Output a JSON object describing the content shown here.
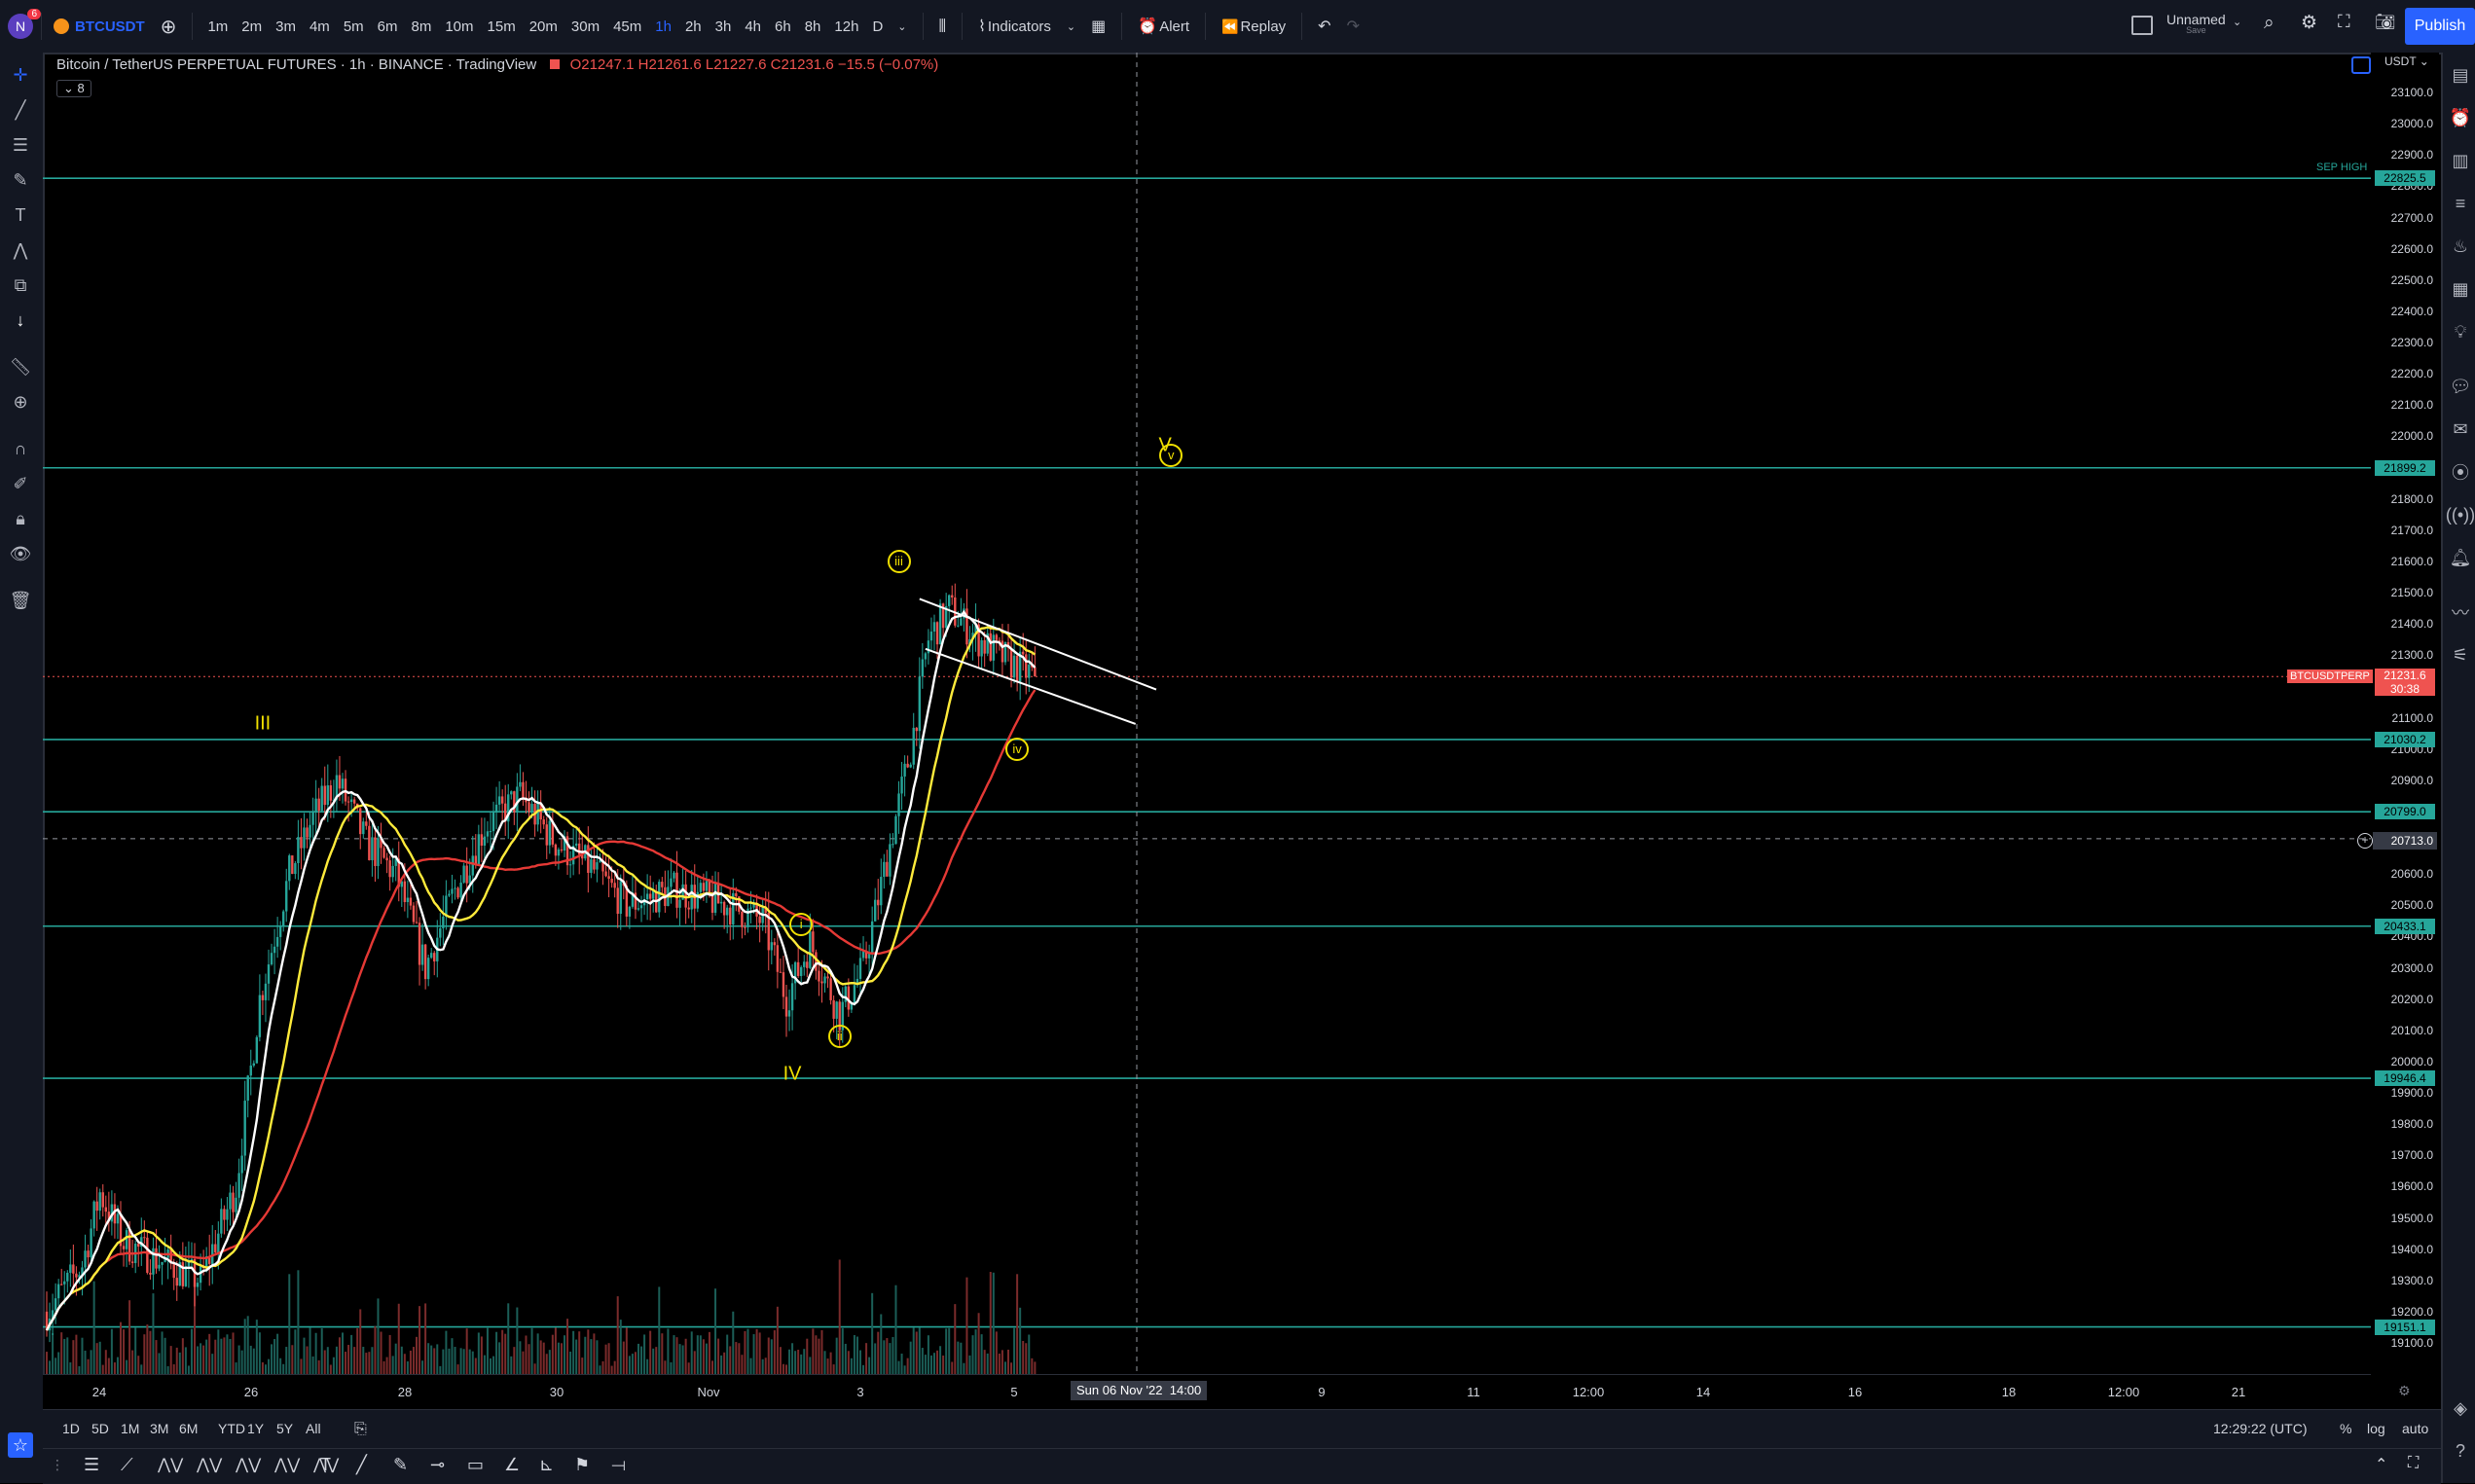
{
  "topbar": {
    "symbol": "BTCUSDT",
    "notif_count": "6",
    "intervals": [
      "1m",
      "2m",
      "3m",
      "4m",
      "5m",
      "6m",
      "8m",
      "10m",
      "15m",
      "20m",
      "30m",
      "45m",
      "1h",
      "2h",
      "3h",
      "4h",
      "6h",
      "8h",
      "12h",
      "D"
    ],
    "active_interval": "1h",
    "indicators_label": "Indicators",
    "alert_label": "Alert",
    "replay_label": "Replay",
    "layout_name": "Unnamed",
    "layout_sub": "Save",
    "publish_label": "Publish"
  },
  "legend": {
    "title": "Bitcoin / TetherUS PERPETUAL FUTURES · 1h · BINANCE · TradingView",
    "open": "O21247.1",
    "high": "H21261.6",
    "low": "L21227.6",
    "close": "C21231.6",
    "change": "−15.5 (−0.07%)",
    "indicator_count": "8"
  },
  "price_scale": {
    "currency": "USDT",
    "ticks": [
      "23100.0",
      "23000.0",
      "22900.0",
      "22800.0",
      "22700.0",
      "22600.0",
      "22500.0",
      "22400.0",
      "22300.0",
      "22200.0",
      "22100.0",
      "22000.0",
      "21900.0",
      "21800.0",
      "21700.0",
      "21600.0",
      "21500.0",
      "21400.0",
      "21300.0",
      "21200.0",
      "21100.0",
      "21000.0",
      "20900.0",
      "20800.0",
      "20700.0",
      "20600.0",
      "20500.0",
      "20400.0",
      "20300.0",
      "20200.0",
      "20100.0",
      "20000.0",
      "19900.0",
      "19800.0",
      "19700.0",
      "19600.0",
      "19500.0",
      "19400.0",
      "19300.0",
      "19200.0",
      "19100.0"
    ],
    "level_labels": [
      "22825.5",
      "21899.2",
      "21030.2",
      "20799.0",
      "20433.1",
      "19946.4",
      "19151.1"
    ],
    "sep_high_label": "SEP HIGH",
    "symbol_tag": "BTCUSDTPERP",
    "last_price": "21231.6",
    "countdown": "30:38",
    "crosshair_price": "20713.0"
  },
  "time_axis": {
    "labels": [
      "24",
      "26",
      "28",
      "30",
      "Nov",
      "3",
      "5",
      "9",
      "11",
      "12:00",
      "14",
      "16",
      "18",
      "12:00",
      "21"
    ],
    "crosshair": "Sun 06 Nov '22",
    "crosshair_time": "14:00"
  },
  "bottom_bar": {
    "ranges": [
      "1D",
      "5D",
      "1M",
      "3M",
      "6M",
      "YTD",
      "1Y",
      "5Y",
      "All"
    ],
    "clock": "12:29:22 (UTC)",
    "pct": "%",
    "log": "log",
    "auto": "auto"
  },
  "annotations": {
    "wave_III": "III",
    "wave_IV": "IV",
    "wave_V": "V",
    "sub_i": "i",
    "sub_ii": "ii",
    "sub_iii": "iii",
    "sub_iv": "iv",
    "sub_v": "v"
  },
  "colors": {
    "horizontal_levels": "#26a69a",
    "ma_fast": "#ffffff",
    "ma_mid": "#ffeb3b",
    "ma_slow": "#e53935",
    "up_candle": "#26a69a",
    "down_candle": "#ef5350",
    "wave_labels": "#f0e000"
  },
  "chart_data": {
    "type": "candlestick",
    "symbol": "BTCUSDT.P",
    "interval": "1h",
    "ylim": [
      19050,
      23150
    ],
    "horizontal_levels": [
      22825.5,
      21899.2,
      21030.2,
      20799.0,
      20433.1,
      19946.4,
      19151.1
    ],
    "last_price": 21231.6,
    "price_path_anchors": [
      {
        "t": 0,
        "p": 19200
      },
      {
        "t": 12,
        "p": 19350
      },
      {
        "t": 18,
        "p": 19580
      },
      {
        "t": 26,
        "p": 19420
      },
      {
        "t": 52,
        "p": 19300
      },
      {
        "t": 64,
        "p": 19600
      },
      {
        "t": 72,
        "p": 20200
      },
      {
        "t": 82,
        "p": 20600
      },
      {
        "t": 90,
        "p": 20780
      },
      {
        "t": 98,
        "p": 20900
      },
      {
        "t": 108,
        "p": 20700
      },
      {
        "t": 118,
        "p": 20600
      },
      {
        "t": 128,
        "p": 20300
      },
      {
        "t": 138,
        "p": 20550
      },
      {
        "t": 148,
        "p": 20750
      },
      {
        "t": 160,
        "p": 20850
      },
      {
        "t": 172,
        "p": 20700
      },
      {
        "t": 184,
        "p": 20620
      },
      {
        "t": 196,
        "p": 20500
      },
      {
        "t": 212,
        "p": 20550
      },
      {
        "t": 230,
        "p": 20500
      },
      {
        "t": 242,
        "p": 20450
      },
      {
        "t": 250,
        "p": 20200
      },
      {
        "t": 258,
        "p": 20380
      },
      {
        "t": 268,
        "p": 20150
      },
      {
        "t": 276,
        "p": 20300
      },
      {
        "t": 284,
        "p": 20650
      },
      {
        "t": 292,
        "p": 21000
      },
      {
        "t": 298,
        "p": 21350
      },
      {
        "t": 305,
        "p": 21450
      },
      {
        "t": 315,
        "p": 21350
      },
      {
        "t": 325,
        "p": 21280
      },
      {
        "t": 334,
        "p": 21231.6
      }
    ],
    "moving_averages": [
      {
        "name": "MA fast",
        "color": "#ffffff",
        "length": 9
      },
      {
        "name": "MA mid",
        "color": "#ffeb3b",
        "length": 21
      },
      {
        "name": "MA slow",
        "color": "#e53935",
        "length": 55
      }
    ],
    "wave_labels": [
      {
        "label": "III",
        "t": 73,
        "p": 21080
      },
      {
        "label": "IV",
        "t": 252,
        "p": 19960
      },
      {
        "label": "V",
        "t": 378,
        "p": 21970
      },
      {
        "label": "i",
        "t": 255,
        "p": 20440
      },
      {
        "label": "ii",
        "t": 268,
        "p": 20080
      },
      {
        "label": "iii",
        "t": 288,
        "p": 21600
      },
      {
        "label": "iv",
        "t": 328,
        "p": 21000
      },
      {
        "label": "v",
        "t": 380,
        "p": 21940
      }
    ]
  }
}
